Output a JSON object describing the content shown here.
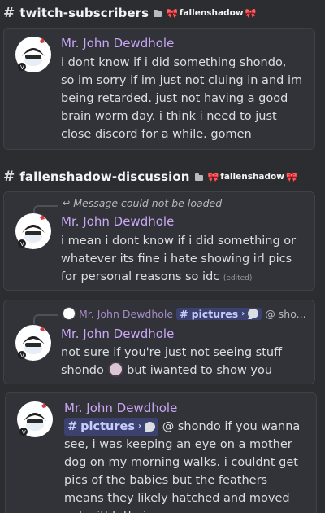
{
  "sections": [
    {
      "channel": "twitch-subscribers",
      "server": "fallenshadow"
    },
    {
      "channel": "fallenshadow-discussion",
      "server": "fallenshadow"
    }
  ],
  "messages": [
    {
      "author": "Mr. John Dewdhole",
      "text": "i dont know if i did something shondo, so im sorry if im just not cluing in and im being retarded. just not having a good brain worm day. i think i need to just close discord for a while. gomen"
    },
    {
      "author": "Mr. John Dewdhole",
      "reply_text": "Message could not be loaded",
      "text": "i mean i dont know if i did something or whatever its fine i hate showing irl pics for personal reasons so idc",
      "edited": "(edited)"
    },
    {
      "author": "Mr. John Dewdhole",
      "reply_author": "Mr. John Dewdhole",
      "reply_channel": "pictures",
      "reply_preview": "@ sho...",
      "text_a": "not sure if you're just not seeing stuff",
      "text_b": "shondo",
      "text_c": "but iwanted to show you"
    },
    {
      "author": "Mr. John Dewdhole",
      "channel_chip": "pictures",
      "line1_rest": "@ shondo if you wanna",
      "text": "see, i was keeping an eye on a mother dog on my morning walks. i couldnt get pics of the babies but the feathers means they likely hatched and moved out withh their"
    }
  ],
  "icons": {
    "hash": "#",
    "bow": "🎀",
    "reply_arrow": "↩",
    "chevron": "›"
  },
  "colors": {
    "background": "#2b2d31",
    "card": "#313338",
    "username": "#c9a7f5",
    "text": "#dbdee1",
    "channel_chip": "#3c4270"
  }
}
